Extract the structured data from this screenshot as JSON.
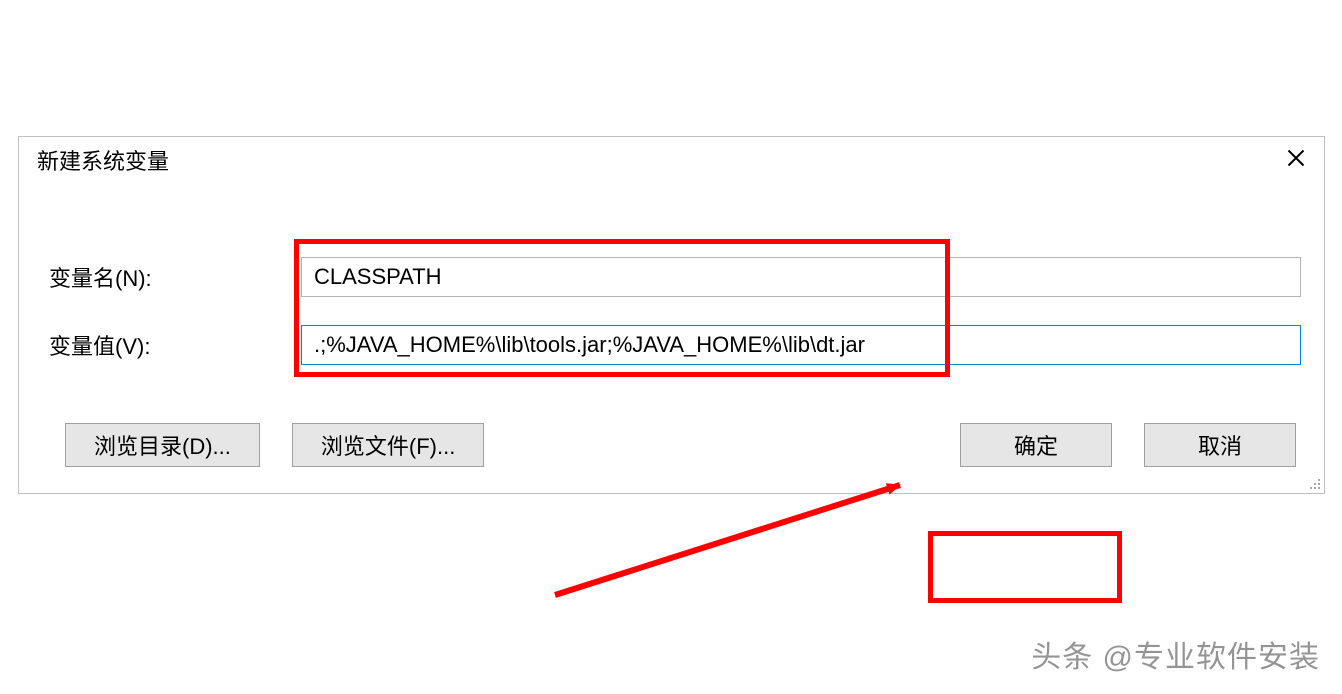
{
  "dialog": {
    "title": "新建系统变量",
    "close_tooltip": "关闭",
    "labels": {
      "name": "变量名(N):",
      "value": "变量值(V):"
    },
    "inputs": {
      "name": "CLASSPATH",
      "value": ".;%JAVA_HOME%\\lib\\tools.jar;%JAVA_HOME%\\lib\\dt.jar"
    },
    "buttons": {
      "browse_dir": "浏览目录(D)...",
      "browse_file": "浏览文件(F)...",
      "ok": "确定",
      "cancel": "取消"
    }
  },
  "annotations": {
    "highlight_inputs": true,
    "highlight_ok_button": true,
    "arrow_to_ok": true
  },
  "watermark": {
    "text": "头条 @专业软件安装"
  }
}
